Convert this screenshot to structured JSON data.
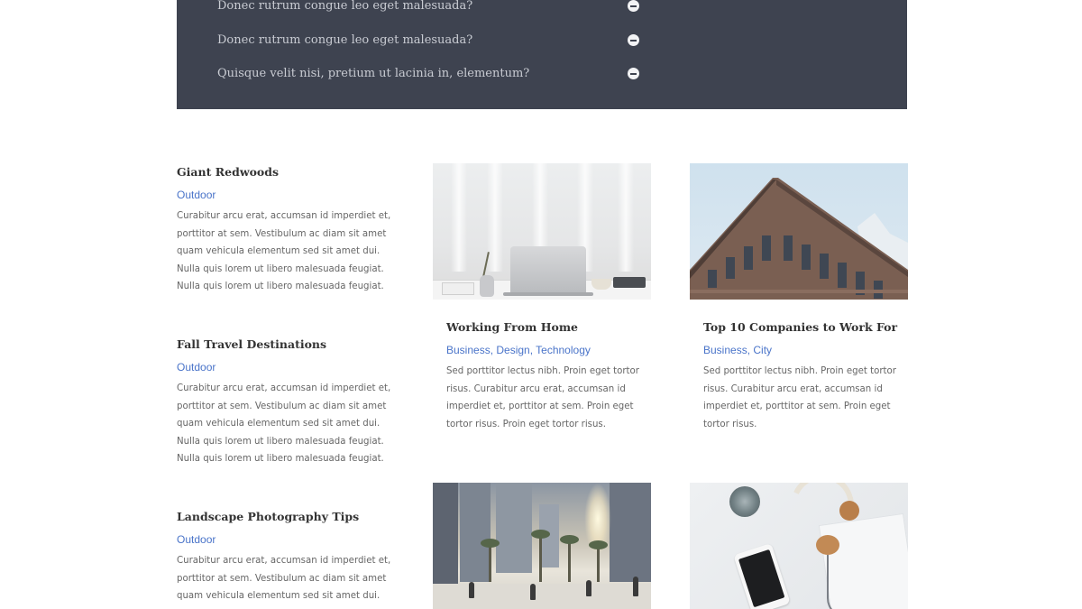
{
  "faq": {
    "items": [
      {
        "question": "Donec rutrum congue leo eget malesuada?"
      },
      {
        "question": "Donec rutrum congue leo eget malesuada?"
      },
      {
        "question": "Quisque velit nisi, pretium ut lacinia in, elementum?"
      }
    ]
  },
  "posts_left": [
    {
      "title": "Giant Redwoods",
      "category": "Outdoor",
      "excerpt": "Curabitur arcu erat, accumsan id imperdiet et, porttitor at sem. Vestibulum ac diam sit amet quam vehicula elementum sed sit amet dui. Nulla quis lorem ut libero malesuada feugiat. Nulla quis lorem ut libero malesuada feugiat."
    },
    {
      "title": "Fall Travel Destinations",
      "category": "Outdoor",
      "excerpt": "Curabitur arcu erat, accumsan id imperdiet et, porttitor at sem. Vestibulum ac diam sit amet quam vehicula elementum sed sit amet dui. Nulla quis lorem ut libero malesuada feugiat. Nulla quis lorem ut libero malesuada feugiat."
    },
    {
      "title": "Landscape Photography Tips",
      "category": "Outdoor",
      "excerpt": "Curabitur arcu erat, accumsan id imperdiet et, porttitor at sem. Vestibulum ac diam sit amet quam vehicula elementum sed sit amet dui."
    }
  ],
  "cards": [
    {
      "image": "laptop-desk",
      "title": "Working From Home",
      "categories": "Business, Design, Technology",
      "excerpt": "Sed porttitor lectus nibh. Proin eget tortor risus. Curabitur arcu erat, accumsan id imperdiet et, porttitor at sem. Proin eget tortor risus. Proin eget tortor risus."
    },
    {
      "image": "building",
      "title": "Top 10 Companies to Work For",
      "categories": "Business, City",
      "excerpt": "Sed porttitor lectus nibh. Proin eget tortor risus. Curabitur arcu erat, accumsan id imperdiet et, porttitor at sem. Proin eget tortor risus."
    },
    {
      "image": "city-street"
    },
    {
      "image": "headphones-phone"
    }
  ],
  "colors": {
    "faq_background": "#3e4350",
    "link_accent": "#4a74c9"
  }
}
